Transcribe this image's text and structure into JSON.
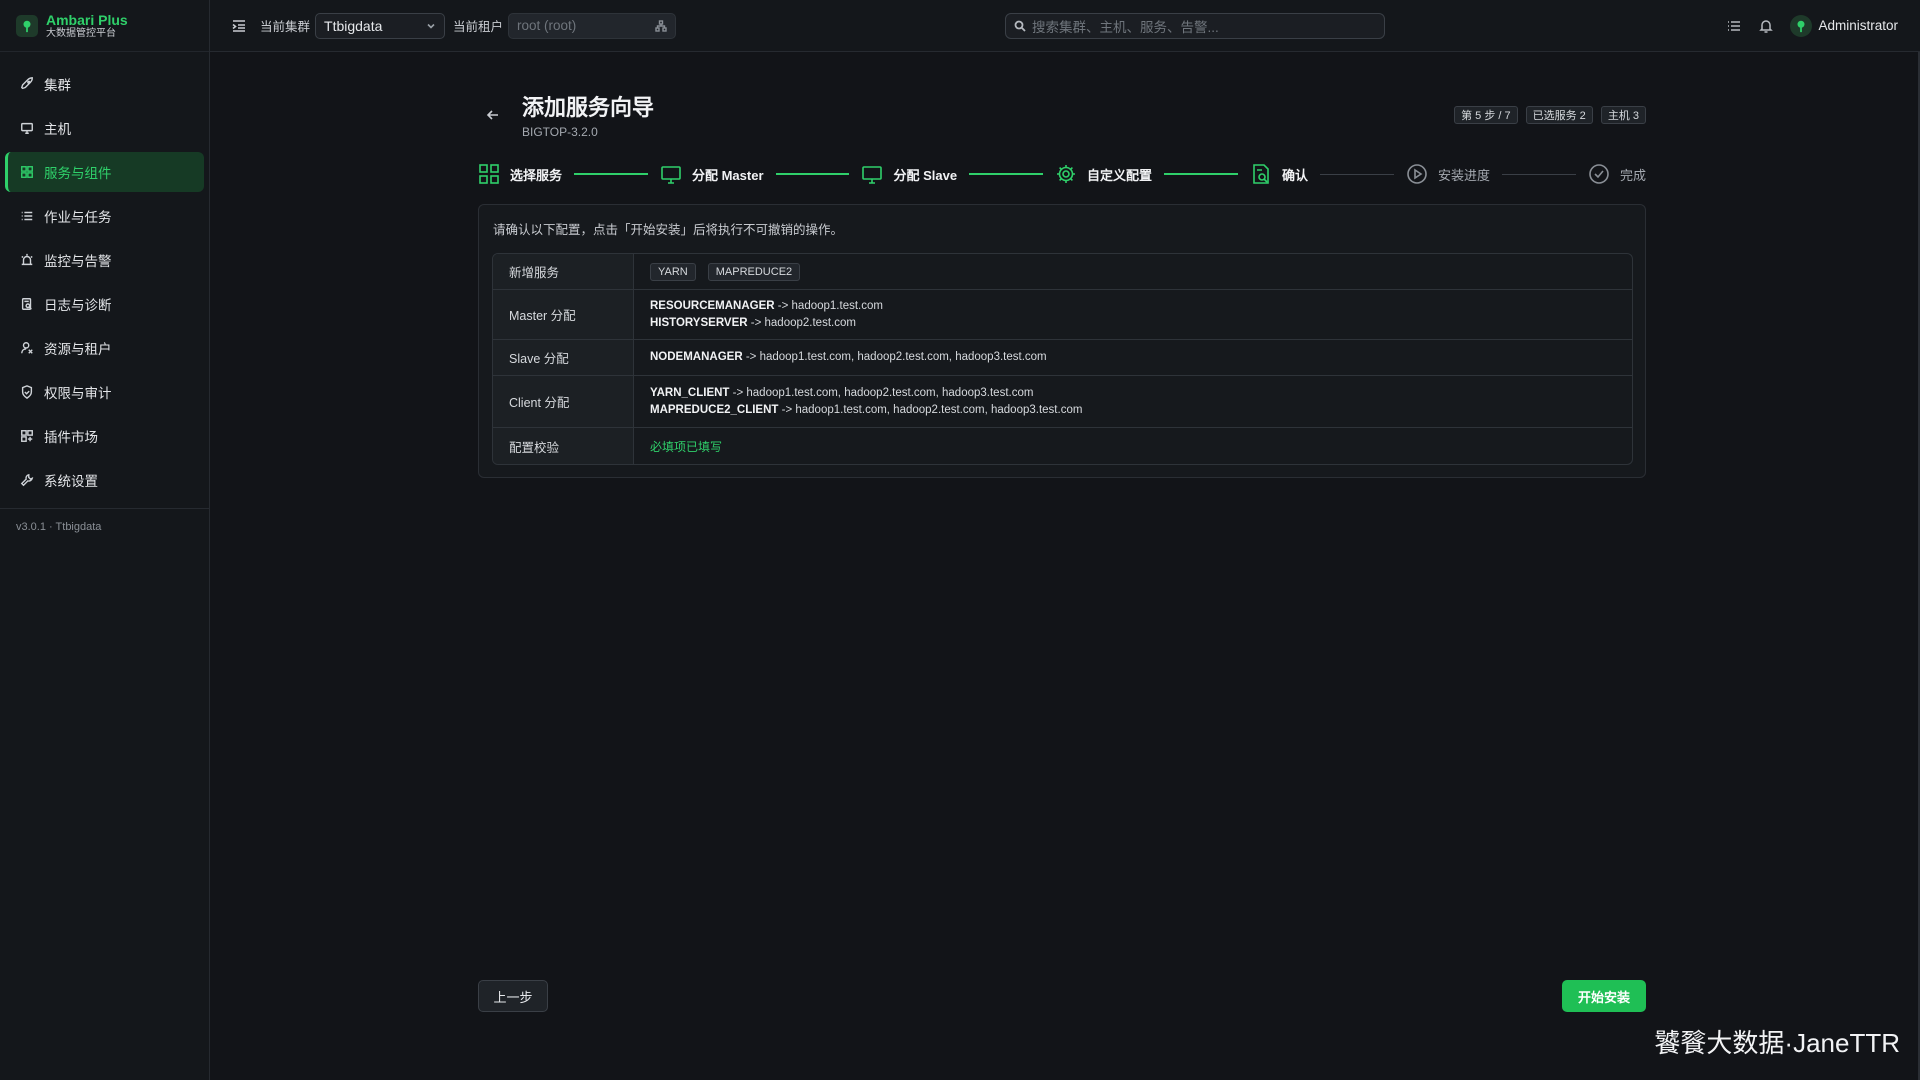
{
  "app": {
    "title": "Ambari Plus",
    "subtitle": "大数据管控平台",
    "version": "v3.0.1 · Ttbigdata"
  },
  "sidebar": {
    "items": [
      {
        "label": "集群",
        "icon": "rocket-icon",
        "active": false
      },
      {
        "label": "主机",
        "icon": "monitor-icon",
        "active": false
      },
      {
        "label": "服务与组件",
        "icon": "grid-icon",
        "active": true
      },
      {
        "label": "作业与任务",
        "icon": "list-icon",
        "active": false
      },
      {
        "label": "监控与告警",
        "icon": "alarm-icon",
        "active": false
      },
      {
        "label": "日志与诊断",
        "icon": "log-icon",
        "active": false
      },
      {
        "label": "资源与租户",
        "icon": "tenant-icon",
        "active": false
      },
      {
        "label": "权限与审计",
        "icon": "shield-icon",
        "active": false
      },
      {
        "label": "插件市场",
        "icon": "plugin-icon",
        "active": false
      },
      {
        "label": "系统设置",
        "icon": "wrench-icon",
        "active": false
      }
    ]
  },
  "topbar": {
    "cluster_label": "当前集群",
    "cluster_value": "Ttbigdata",
    "tenant_label": "当前租户",
    "tenant_placeholder": "root (root)",
    "search_placeholder": "搜索集群、主机、服务、告警...",
    "user_name": "Administrator"
  },
  "page": {
    "title": "添加服务向导",
    "subtitle": "BIGTOP-3.2.0",
    "badges": [
      "第 5 步 / 7",
      "已选服务 2",
      "主机 3"
    ]
  },
  "steps": [
    {
      "label": "选择服务",
      "icon": "grid-icon",
      "state": "done"
    },
    {
      "label": "分配 Master",
      "icon": "monitor-icon",
      "state": "done"
    },
    {
      "label": "分配 Slave",
      "icon": "monitor-icon",
      "state": "done"
    },
    {
      "label": "自定义配置",
      "icon": "gear-icon",
      "state": "done"
    },
    {
      "label": "确认",
      "icon": "document-search-icon",
      "state": "current"
    },
    {
      "label": "安装进度",
      "icon": "play-circle-icon",
      "state": "pending"
    },
    {
      "label": "完成",
      "icon": "check-circle-icon",
      "state": "pending"
    }
  ],
  "confirm": {
    "hint": "请确认以下配置，点击「开始安装」后将执行不可撤销的操作。",
    "rows": {
      "new_services": {
        "key": "新增服务",
        "tags": [
          "YARN",
          "MAPREDUCE2"
        ]
      },
      "master": {
        "key": "Master 分配",
        "lines": [
          {
            "component": "RESOURCEMANAGER",
            "hosts": " -> hadoop1.test.com"
          },
          {
            "component": "HISTORYSERVER",
            "hosts": " -> hadoop2.test.com"
          }
        ]
      },
      "slave": {
        "key": "Slave 分配",
        "lines": [
          {
            "component": "NODEMANAGER",
            "hosts": " -> hadoop1.test.com, hadoop2.test.com, hadoop3.test.com"
          }
        ]
      },
      "client": {
        "key": "Client 分配",
        "lines": [
          {
            "component": "YARN_CLIENT",
            "hosts": " -> hadoop1.test.com, hadoop2.test.com, hadoop3.test.com"
          },
          {
            "component": "MAPREDUCE2_CLIENT",
            "hosts": " -> hadoop1.test.com, hadoop2.test.com, hadoop3.test.com"
          }
        ]
      },
      "validation": {
        "key": "配置校验",
        "value": "必填项已填写"
      }
    }
  },
  "actions": {
    "prev_label": "上一步",
    "start_label": "开始安装"
  },
  "watermark": "饕餮大数据·JaneTTR",
  "colors": {
    "accent": "#2fd06a",
    "primary_button": "#1fbf55",
    "background": "#121418"
  }
}
